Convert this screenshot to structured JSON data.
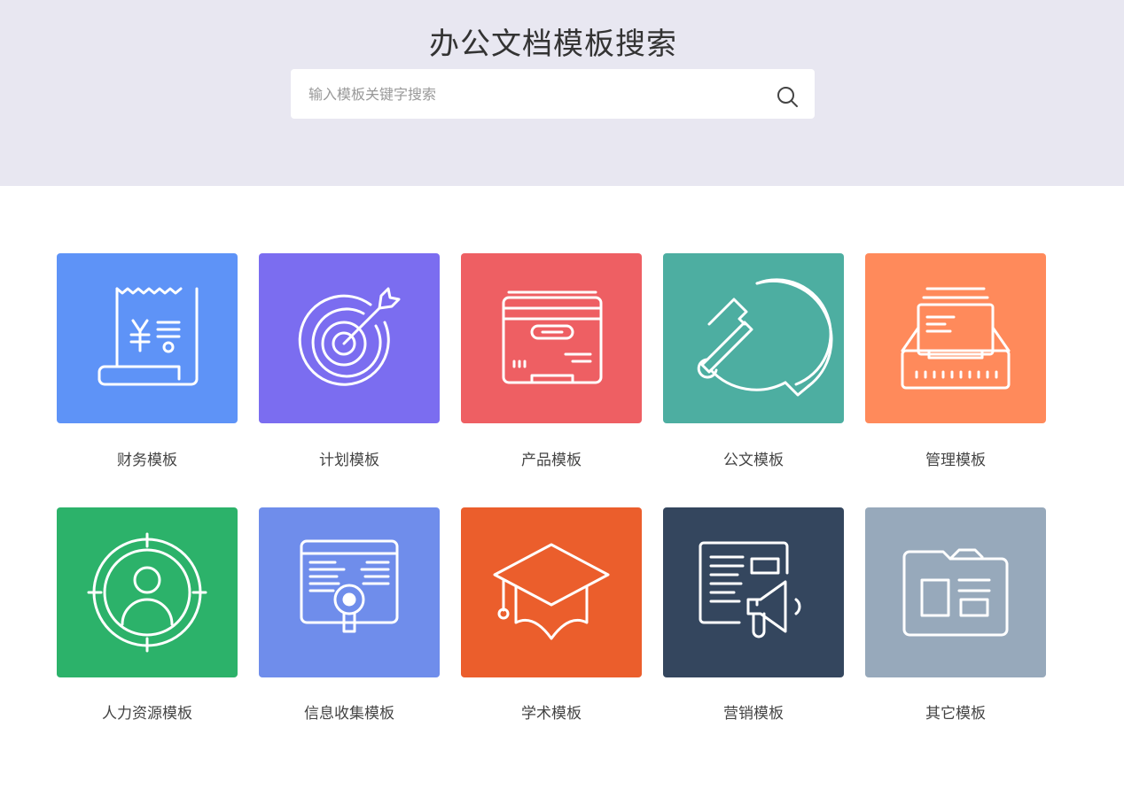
{
  "header": {
    "title": "办公文档模板搜索",
    "search_placeholder": "输入模板关键字搜索",
    "search_value": ""
  },
  "categories": [
    {
      "label": "财务模板",
      "icon": "receipt-yen-icon",
      "color": "#5e93f7"
    },
    {
      "label": "计划模板",
      "icon": "target-arrow-icon",
      "color": "#7b6df0"
    },
    {
      "label": "产品模板",
      "icon": "product-box-icon",
      "color": "#ee5f63"
    },
    {
      "label": "公文模板",
      "icon": "hammer-sickle-icon",
      "color": "#4daea1"
    },
    {
      "label": "管理模板",
      "icon": "file-tray-icon",
      "color": "#ff8a5b"
    },
    {
      "label": "人力资源模板",
      "icon": "person-target-icon",
      "color": "#2cb26a"
    },
    {
      "label": "信息收集模板",
      "icon": "data-search-icon",
      "color": "#6f8deb"
    },
    {
      "label": "学术模板",
      "icon": "graduation-cap-icon",
      "color": "#eb5e2c"
    },
    {
      "label": "营销模板",
      "icon": "megaphone-board-icon",
      "color": "#34465e"
    },
    {
      "label": "其它模板",
      "icon": "folder-icon",
      "color": "#97a9bb"
    }
  ]
}
